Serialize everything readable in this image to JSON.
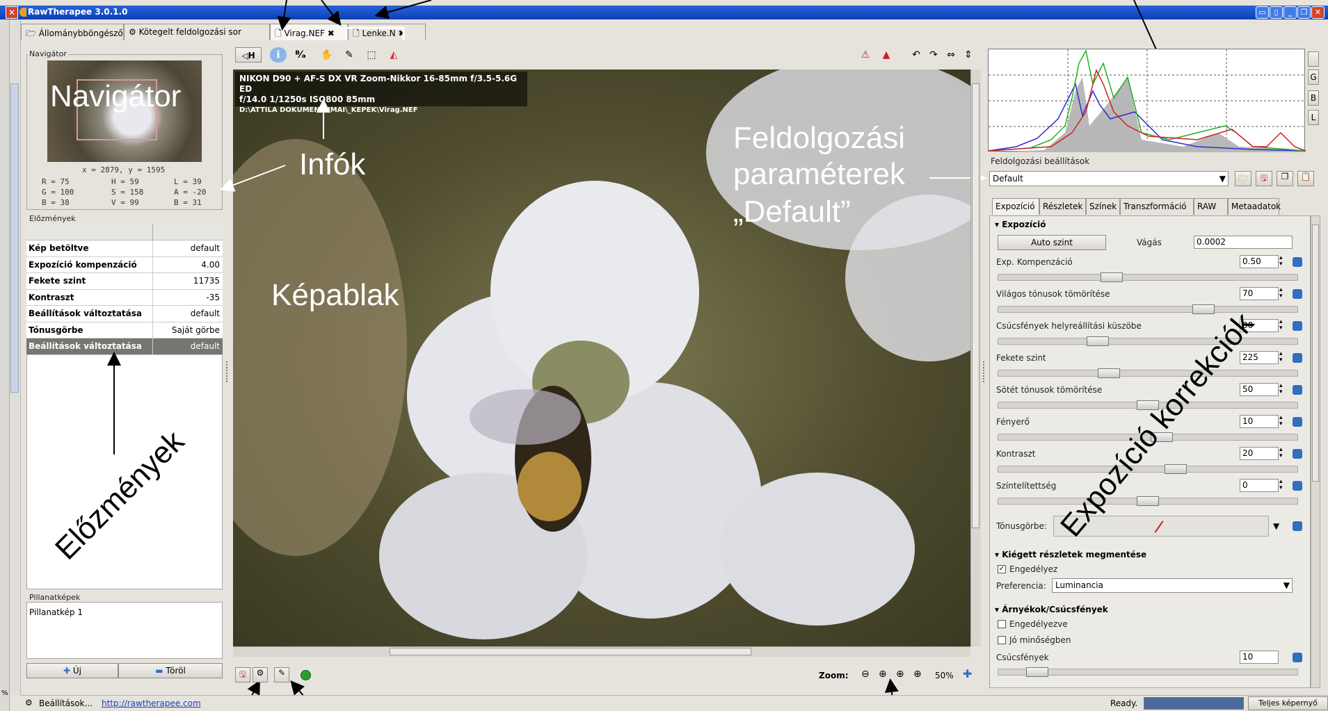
{
  "window": {
    "title": "RawTherapee 3.0.1.0"
  },
  "tabs": [
    {
      "label": "Állománybböngésző"
    },
    {
      "label": "Kötegelt feldolgozási sor"
    },
    {
      "label": "Virag.NEF"
    },
    {
      "label": "Lenke.N"
    }
  ],
  "navigator": {
    "group_label": "Navigátor",
    "overlay_label": "Navigátor",
    "coords": "x = 2879, y = 1595",
    "stats": {
      "r": "R = 75",
      "h": "H = 59",
      "l": "L = 39",
      "g": "G = 100",
      "s": "S = 158",
      "a": "A = -20",
      "b": "B = 38",
      "v": "V = 99",
      "b2": "B = 31"
    }
  },
  "history": {
    "group_label": "Előzmények",
    "rows": [
      {
        "action": "Kép betöltve",
        "value": "default"
      },
      {
        "action": "Expozíció kompenzáció",
        "value": "4.00"
      },
      {
        "action": "Fekete szint",
        "value": "11735"
      },
      {
        "action": "Kontraszt",
        "value": "-35"
      },
      {
        "action": "Beállítások változtatása",
        "value": "default"
      },
      {
        "action": "Tónusgörbe",
        "value": "Saját görbe"
      },
      {
        "action": "Beállítások változtatása",
        "value": "default"
      }
    ],
    "overlay_label": "Előzmények"
  },
  "snapshots": {
    "group_label": "Pillanatképek",
    "items": [
      "Pillanatkép 1"
    ],
    "new_label": "Új",
    "delete_label": "Töröl"
  },
  "image": {
    "info_line1": "NIKON D90 + AF-S DX VR Zoom-Nikkor 16-85mm f/3.5-5.6G ED",
    "info_line2": "f/14.0  1/1250s  ISO800  85mm",
    "info_line3": "D:\\ATTILA DOKUMENTUMAI\\_KEPEK\\Virag.NEF",
    "overlay_infok": "Infók",
    "overlay_kepablak": "Képablak",
    "overlay_params1": "Feldolgozási",
    "overlay_params2": "paraméterek",
    "overlay_params3": "„Default”",
    "toolbar_h": "H"
  },
  "zoom": {
    "label": "Zoom:",
    "value": "50%"
  },
  "right_panel": {
    "histogram_buttons": [
      "",
      "G",
      "B",
      "L"
    ],
    "profiles_label": "Feldolgozási beállítások",
    "profile_value": "Default",
    "tabs": [
      "Expozíció",
      "Részletek",
      "Színek",
      "Transzformáció",
      "RAW",
      "Metaadatok"
    ],
    "exposure": {
      "header": "Expozíció",
      "auto_level": "Auto szint",
      "clip_label": "Vágás",
      "clip_value": "0.0002",
      "params": [
        {
          "label": "Exp. Kompenzáció",
          "value": "0.50",
          "level": 0.37
        },
        {
          "label": "Világos tónusok tömörítése",
          "value": "70",
          "level": 0.7
        },
        {
          "label": "Csúcsfények helyreállítási küszöbe",
          "value": "30",
          "level": 0.32
        },
        {
          "label": "Fekete szint",
          "value": "225",
          "level": 0.36
        },
        {
          "label": "Sötét tónusok tömörítése",
          "value": "50",
          "level": 0.5
        },
        {
          "label": "Fényerő",
          "value": "10",
          "level": 0.55
        },
        {
          "label": "Kontraszt",
          "value": "20",
          "level": 0.6
        },
        {
          "label": "Színtelítettség",
          "value": "0",
          "level": 0.5
        }
      ],
      "curve_label": "Tónusgörbe:"
    },
    "highlights": {
      "header": "Kiégett részletek megmentése",
      "enable_label": "Engedélyez",
      "pref_label": "Preferencia:",
      "pref_value": "Luminancia"
    },
    "shadows": {
      "header": "Árnyékok/Csúcsfények",
      "enable_label": "Engedélyezve",
      "hq_label": "Jó minőségben",
      "highlights_label": "Csúcsfények",
      "highlights_value": "10",
      "level": 0.1
    },
    "overlay_label": "Expozíció korrekciók"
  },
  "statusbar": {
    "settings": "Beállítások...",
    "link": "http://rawtherapee.com",
    "ready": "Ready.",
    "fullscreen": "Teljes képernyő"
  },
  "colors": {
    "titlebar": "#0a3fb8",
    "accent": "#2f6fbf",
    "warning": "#d41a1a"
  }
}
